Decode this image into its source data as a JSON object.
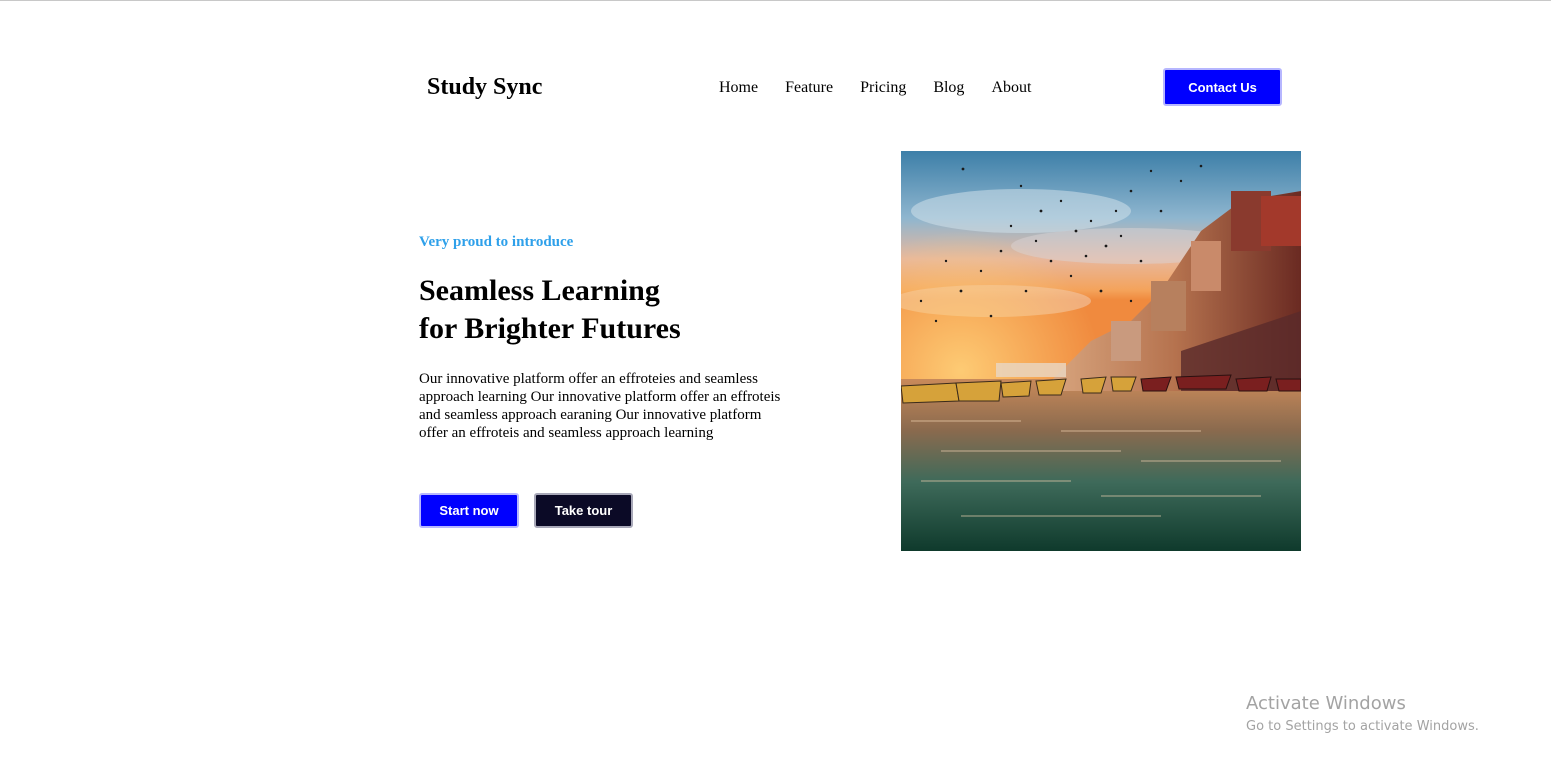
{
  "header": {
    "logo": "Study Sync",
    "nav": [
      "Home",
      "Feature",
      "Pricing",
      "Blog",
      "About"
    ],
    "contact_label": "Contact Us"
  },
  "hero": {
    "eyebrow": "Very proud to introduce",
    "headline_line1": "Seamless Learning",
    "headline_line2": "for Brighter Futures",
    "description": "Our innovative platform offer an effroteies and seamless approach learning Our innovative platform offer an effroteis and seamless approach earaning Our innovative platform offer an effroteis and seamless approach learning",
    "start_label": "Start now",
    "tour_label": "Take tour",
    "image_icon": "river-ghats-photo"
  },
  "watermark": {
    "title": "Activate Windows",
    "subtitle": "Go to Settings to activate Windows."
  },
  "colors": {
    "primary": "#0000ff",
    "dark": "#0b0a26",
    "accent": "#2ea0ea"
  }
}
